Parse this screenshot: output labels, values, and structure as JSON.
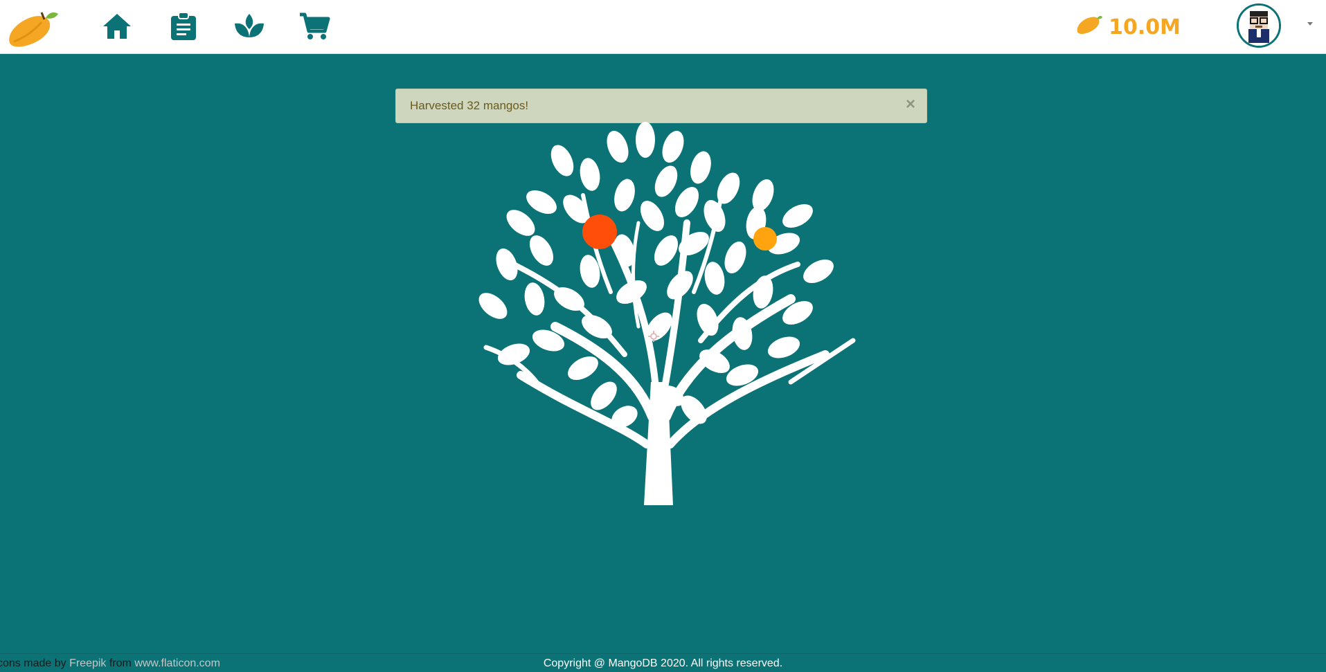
{
  "navbar": {
    "logo_icon": "mango-logo-icon",
    "items": [
      {
        "name": "home",
        "icon": "home-icon"
      },
      {
        "name": "tasks",
        "icon": "clipboard-icon"
      },
      {
        "name": "farm",
        "icon": "sprout-icon"
      },
      {
        "name": "shop",
        "icon": "cart-icon"
      }
    ],
    "balance": {
      "icon": "mango-coin-icon",
      "amount": "10.0M"
    },
    "avatar_icon": "pixel-avatar-icon"
  },
  "alert": {
    "message": "Harvested 32 mangos!",
    "close_label": "×"
  },
  "tree": {
    "icon": "mango-tree-icon",
    "mangos": [
      {
        "color": "#ff4e0a"
      },
      {
        "color": "#ffa30f"
      }
    ]
  },
  "footer": {
    "credit_prefix": "cons made by ",
    "credit_author": "Freepik",
    "credit_middle": " from ",
    "credit_site": "www.flaticon.com",
    "copyright": "Copyright @ MangoDB 2020. All rights reserved."
  },
  "colors": {
    "background": "#0b7276",
    "accent": "#f5a623",
    "nav_icon": "#0b7276",
    "alert_bg": "#cfd6be"
  }
}
